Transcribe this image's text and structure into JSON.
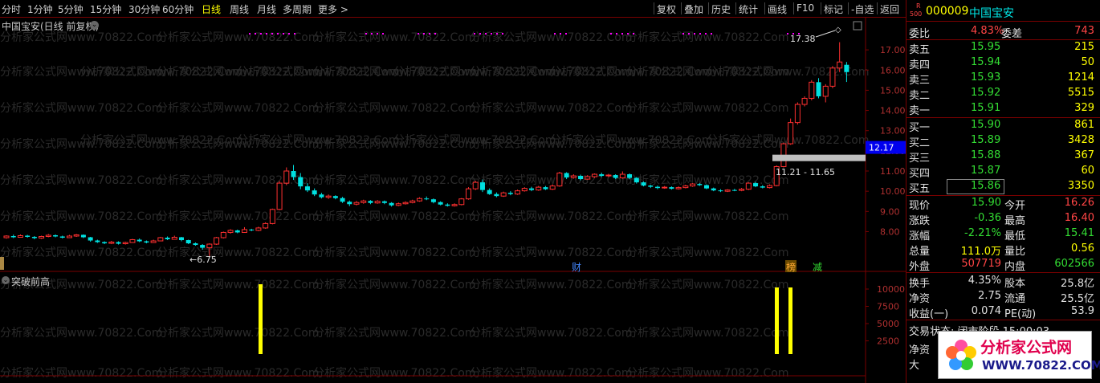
{
  "toolbar": {
    "left_items": [
      "分时",
      "1分钟",
      "5分钟",
      "15分钟",
      "30分钟",
      "60分钟",
      "日线",
      "周线",
      "月线",
      "多周期",
      "更多 >"
    ],
    "active_index": 6,
    "right_items": [
      "复权",
      "叠加",
      "历史",
      "统计",
      "画线",
      "F10",
      "标记",
      "-自选",
      "返回"
    ]
  },
  "chart_title": "中国宝安(日线 前复权)",
  "indicator_title": "突破前高",
  "watermark_text": "分析家公式网www.70822.Com",
  "price_axis": [
    "17.00",
    "16.00",
    "15.00",
    "14.00",
    "13.00",
    "12.00",
    "11.00",
    "10.00",
    "9.00",
    "8.00"
  ],
  "volume_axis": [
    "10000",
    "7500",
    "5000",
    "2500"
  ],
  "current_price_tag": "12.17",
  "annotations": {
    "high_label": "17.38",
    "low_label": "6.75",
    "range_label": "11.21 - 11.65",
    "event_cai": "财",
    "event_bang": "榜",
    "event_jian": "减"
  },
  "stock": {
    "r_label": "R",
    "r_num": "500",
    "code": "000009",
    "name": "中国宝安"
  },
  "weibi": {
    "label": "委比",
    "pct": "4.83%",
    "diff_label": "委差",
    "diff": "743"
  },
  "asks": [
    {
      "label": "卖五",
      "price": "15.95",
      "vol": "215"
    },
    {
      "label": "卖四",
      "price": "15.94",
      "vol": "50"
    },
    {
      "label": "卖三",
      "price": "15.93",
      "vol": "1214"
    },
    {
      "label": "卖二",
      "price": "15.92",
      "vol": "5515"
    },
    {
      "label": "卖一",
      "price": "15.91",
      "vol": "329"
    }
  ],
  "bids": [
    {
      "label": "买一",
      "price": "15.90",
      "vol": "861"
    },
    {
      "label": "买二",
      "price": "15.89",
      "vol": "3428"
    },
    {
      "label": "买三",
      "price": "15.88",
      "vol": "367"
    },
    {
      "label": "买四",
      "price": "15.87",
      "vol": "60"
    },
    {
      "label": "买五",
      "price": "15.86",
      "vol": "3350"
    }
  ],
  "quote": [
    {
      "l1": "现价",
      "v1": "15.90",
      "c1": "green",
      "l2": "今开",
      "v2": "16.26",
      "c2": "red"
    },
    {
      "l1": "涨跌",
      "v1": "-0.36",
      "c1": "green",
      "l2": "最高",
      "v2": "16.40",
      "c2": "red"
    },
    {
      "l1": "涨幅",
      "v1": "-2.21%",
      "c1": "green",
      "l2": "最低",
      "v2": "15.41",
      "c2": "green"
    },
    {
      "l1": "总量",
      "v1": "111.0万",
      "c1": "yellow",
      "l2": "量比",
      "v2": "0.56",
      "c2": "yellow"
    },
    {
      "l1": "外盘",
      "v1": "507719",
      "c1": "red",
      "l2": "内盘",
      "v2": "602566",
      "c2": "green"
    }
  ],
  "fundamentals": [
    {
      "l1": "换手",
      "v1": "4.35%",
      "l2": "股本",
      "v2": "25.8亿"
    },
    {
      "l1": "净资",
      "v1": "2.75",
      "l2": "流通",
      "v2": "25.5亿"
    },
    {
      "l1": "收益(一)",
      "v1": "0.074",
      "l2": "PE(动)",
      "v2": "53.9"
    }
  ],
  "trade_status": "交易状态: 闭市阶段 15:00:03",
  "net_label": "净资",
  "big_label": "大",
  "logo": {
    "title": "分析家公式网",
    "url": "WWW.70822.COM"
  },
  "colors": {
    "up": "#ff3030",
    "down": "#00e0e0",
    "volume_bar": "#ffff00",
    "grid": "#7a0000",
    "marker": "#ff00ff"
  }
}
